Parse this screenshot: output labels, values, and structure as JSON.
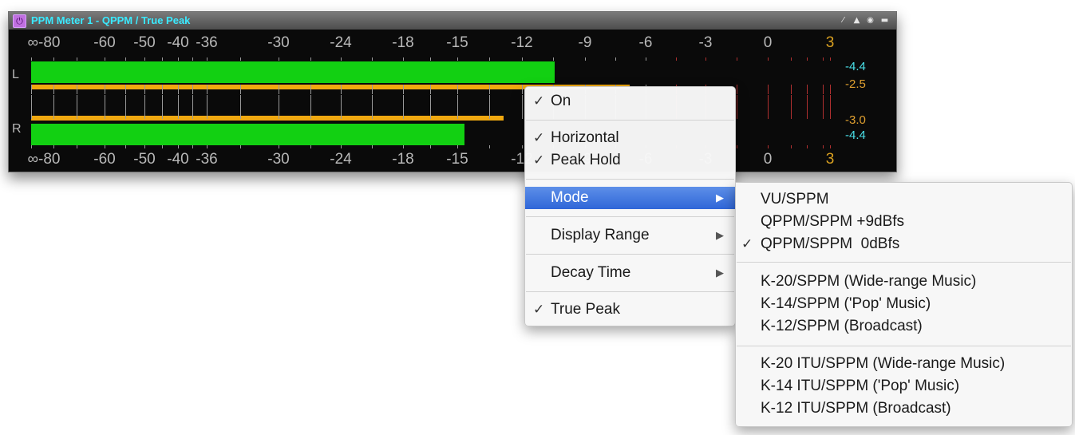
{
  "window": {
    "title": "PPM Meter 1 - QPPM / True Peak",
    "power_glyph": "⏻",
    "title_buttons": [
      {
        "name": "wand-icon",
        "glyph": "⁄"
      },
      {
        "name": "person-icon",
        "glyph": "▲"
      },
      {
        "name": "eye-icon",
        "glyph": "◉"
      },
      {
        "name": "minimize-icon",
        "glyph": "▬"
      }
    ]
  },
  "scale": {
    "labels": [
      "∞-80",
      "-60",
      "-50",
      "-40",
      "-36",
      "-30",
      "-24",
      "-18",
      "-15",
      "-12",
      "-9",
      "-6",
      "-3",
      "0",
      "3"
    ]
  },
  "channels": {
    "left": {
      "label": "L"
    },
    "right": {
      "label": "R"
    }
  },
  "readouts": {
    "l_rms": "-4.4",
    "l_peak": "-2.5",
    "r_peak": "-3.0",
    "r_rms": "-4.4"
  },
  "colors": {
    "level_bar": "#12d012",
    "peak_bar": "#f0a810",
    "readout_rms": "#4ae0e8",
    "readout_peak": "#e0a030",
    "title": "#3aeaff",
    "menu_highlight": "#3a72e0"
  },
  "context_menu": {
    "items": [
      {
        "label": "On",
        "checked": true
      },
      {
        "label": "Horizontal",
        "checked": true
      },
      {
        "label": "Peak Hold",
        "checked": true
      },
      {
        "label": "Mode",
        "checked": false,
        "submenu": true,
        "highlighted": true
      },
      {
        "label": "Display Range",
        "checked": false,
        "submenu": true
      },
      {
        "label": "Decay Time",
        "checked": false,
        "submenu": true
      },
      {
        "label": "True Peak",
        "checked": true
      }
    ]
  },
  "mode_submenu": {
    "items": [
      {
        "label": "VU/SPPM",
        "checked": false
      },
      {
        "label": "QPPM/SPPM +9dBfs",
        "checked": false
      },
      {
        "label": "QPPM/SPPM  0dBfs",
        "checked": true
      },
      {
        "label": "K-20/SPPM (Wide-range Music)",
        "checked": false
      },
      {
        "label": "K-14/SPPM ('Pop' Music)",
        "checked": false
      },
      {
        "label": "K-12/SPPM (Broadcast)",
        "checked": false
      },
      {
        "label": "K-20 ITU/SPPM (Wide-range Music)",
        "checked": false
      },
      {
        "label": "K-14 ITU/SPPM ('Pop' Music)",
        "checked": false
      },
      {
        "label": "K-12 ITU/SPPM (Broadcast)",
        "checked": false
      }
    ]
  },
  "glyphs": {
    "check": "✓",
    "submenu_arrow": "▶"
  }
}
